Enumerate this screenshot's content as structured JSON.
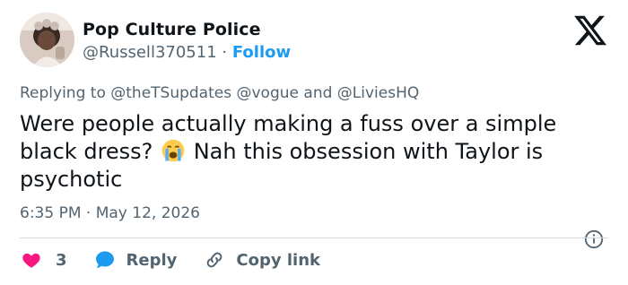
{
  "author": {
    "name": "Pop Culture Police",
    "handle": "@Russell370511",
    "separator": "·",
    "follow_label": "Follow"
  },
  "reply_context": {
    "prefix": "Replying to",
    "mentions": [
      "@theTSupdates",
      "@vogue",
      "@LiviesHQ"
    ],
    "joiner": "and"
  },
  "tweet": {
    "text_part1": "Were people actually making a fuss over a simple black dress?",
    "emoji": "loudly-crying-face",
    "text_part2": "Nah this obsession with Taylor is psychotic"
  },
  "meta": {
    "time": "6:35 PM",
    "separator": "·",
    "date": "May 12, 2026"
  },
  "actions": {
    "like_count": "3",
    "reply_label": "Reply",
    "copy_link_label": "Copy link"
  },
  "colors": {
    "like": "#f91880",
    "reply": "#1d9bf0",
    "follow": "#1d9bf0",
    "secondary_text": "#536471",
    "primary_text": "#0f1419"
  }
}
